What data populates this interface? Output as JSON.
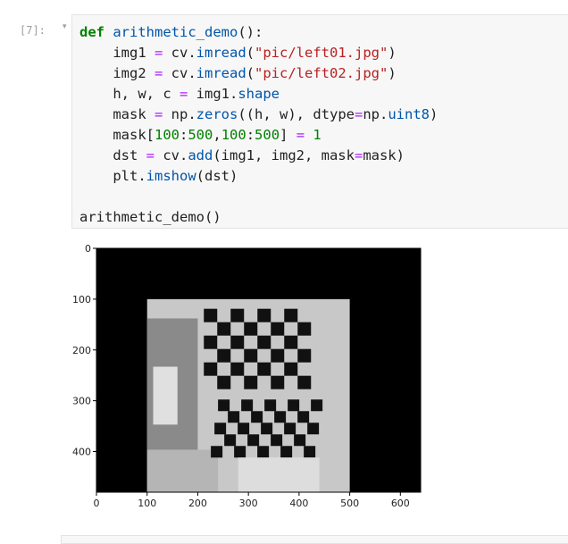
{
  "cell": {
    "prompt": "[7]:",
    "collapse_glyph": "▾",
    "code_lines": [
      [
        {
          "t": "def",
          "c": "kw"
        },
        {
          "t": " "
        },
        {
          "t": "arithmetic_demo",
          "c": "def"
        },
        {
          "t": "():"
        }
      ],
      [
        {
          "t": "    img1 "
        },
        {
          "t": "=",
          "c": "op"
        },
        {
          "t": " cv."
        },
        {
          "t": "imread",
          "c": "def"
        },
        {
          "t": "("
        },
        {
          "t": "\"pic/left01.jpg\"",
          "c": "str"
        },
        {
          "t": ")"
        }
      ],
      [
        {
          "t": "    img2 "
        },
        {
          "t": "=",
          "c": "op"
        },
        {
          "t": " cv."
        },
        {
          "t": "imread",
          "c": "def"
        },
        {
          "t": "("
        },
        {
          "t": "\"pic/left02.jpg\"",
          "c": "str"
        },
        {
          "t": ")"
        }
      ],
      [
        {
          "t": "    h, w, c "
        },
        {
          "t": "=",
          "c": "op"
        },
        {
          "t": " img1."
        },
        {
          "t": "shape",
          "c": "def"
        }
      ],
      [
        {
          "t": "    mask "
        },
        {
          "t": "=",
          "c": "op"
        },
        {
          "t": " np."
        },
        {
          "t": "zeros",
          "c": "def"
        },
        {
          "t": "((h, w), dtype"
        },
        {
          "t": "=",
          "c": "op"
        },
        {
          "t": "np."
        },
        {
          "t": "uint8",
          "c": "def"
        },
        {
          "t": ")"
        }
      ],
      [
        {
          "t": "    mask["
        },
        {
          "t": "100",
          "c": "num"
        },
        {
          "t": ":"
        },
        {
          "t": "500",
          "c": "num"
        },
        {
          "t": ","
        },
        {
          "t": "100",
          "c": "num"
        },
        {
          "t": ":"
        },
        {
          "t": "500",
          "c": "num"
        },
        {
          "t": "] "
        },
        {
          "t": "=",
          "c": "op"
        },
        {
          "t": " "
        },
        {
          "t": "1",
          "c": "num"
        }
      ],
      [
        {
          "t": "    dst "
        },
        {
          "t": "=",
          "c": "op"
        },
        {
          "t": " cv."
        },
        {
          "t": "add",
          "c": "def"
        },
        {
          "t": "(img1, img2, mask"
        },
        {
          "t": "=",
          "c": "op"
        },
        {
          "t": "mask)"
        }
      ],
      [
        {
          "t": "    plt."
        },
        {
          "t": "imshow",
          "c": "def"
        },
        {
          "t": "(dst)"
        }
      ],
      [
        {
          "t": ""
        }
      ],
      [
        {
          "t": "arithmetic_demo()"
        }
      ]
    ]
  },
  "output": {
    "plot": {
      "x_ticks": [
        "0",
        "100",
        "200",
        "300",
        "400",
        "500",
        "600"
      ],
      "y_ticks": [
        "0",
        "100",
        "200",
        "300",
        "400"
      ],
      "image_shape": [
        480,
        640
      ],
      "mask_region": [
        100,
        500,
        100,
        500
      ]
    }
  }
}
